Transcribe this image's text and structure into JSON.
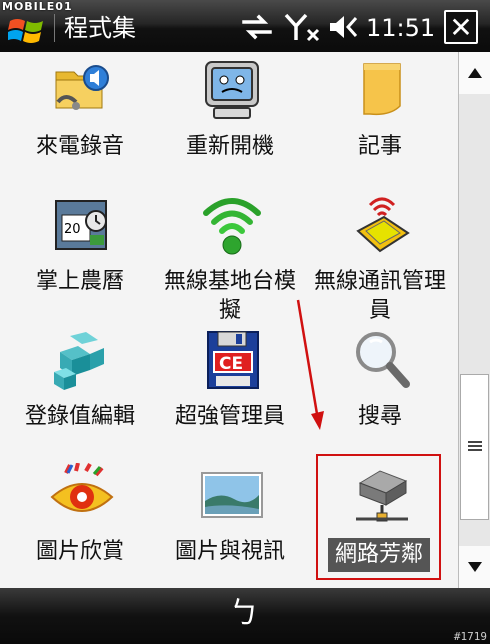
{
  "watermark": "MOBILE01",
  "titlebar": {
    "app_title": "程式集",
    "time": "11:51",
    "close_label": "✕"
  },
  "status_icons": [
    "connectivity-icon",
    "no-signal-icon",
    "volume-muted-icon"
  ],
  "programs": [
    {
      "label": "來電錄音",
      "icon": "call-recorder-icon"
    },
    {
      "label": "重新開機",
      "icon": "restart-icon"
    },
    {
      "label": "記事",
      "icon": "notes-icon"
    },
    {
      "label": "掌上農曆",
      "icon": "lunar-calendar-icon"
    },
    {
      "label": "無線基地台模擬",
      "icon": "wireless-hotspot-icon"
    },
    {
      "label": "無線通訊管理員",
      "icon": "wireless-manager-icon"
    },
    {
      "label": "登錄值編輯",
      "icon": "registry-editor-icon"
    },
    {
      "label": "超強管理員",
      "icon": "ce-manager-icon"
    },
    {
      "label": "搜尋",
      "icon": "search-icon"
    },
    {
      "label": "圖片欣賞",
      "icon": "picture-viewer-icon"
    },
    {
      "label": "圖片與視訊",
      "icon": "pictures-videos-icon"
    },
    {
      "label": "網路芳鄰",
      "icon": "network-neighborhood-icon"
    }
  ],
  "softkey": {
    "label": "ㄅ"
  },
  "image_id": "#1719",
  "colors": {
    "highlight_border": "#d01010",
    "arrow": "#d01010",
    "selection_bg": "#555555"
  }
}
